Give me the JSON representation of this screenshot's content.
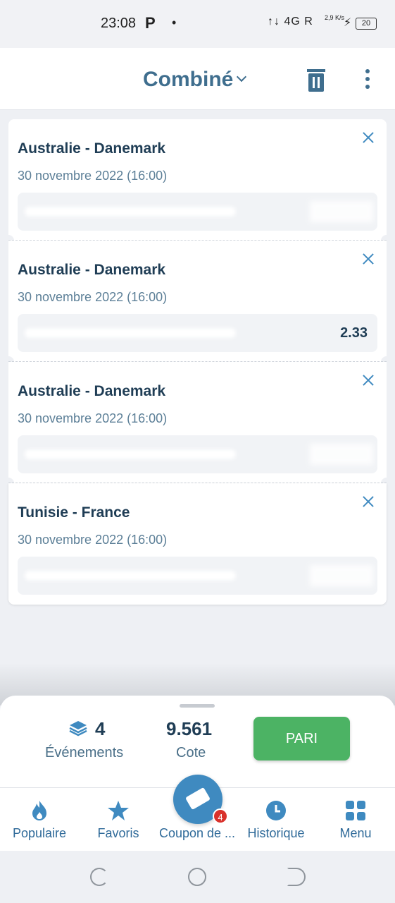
{
  "status_bar": {
    "time": "23:08",
    "app_indicator": "P",
    "dot": "•",
    "network": "↑↓ 4G R",
    "speed": "2,9 K/s",
    "battery": "20"
  },
  "header": {
    "title": "Combiné"
  },
  "bets": [
    {
      "match": "Australie - Danemark",
      "date": "30 novembre 2022 (16:00)",
      "odd": ""
    },
    {
      "match": "Australie - Danemark",
      "date": "30 novembre 2022 (16:00)",
      "odd": "2.33"
    },
    {
      "match": "Australie - Danemark",
      "date": "30 novembre 2022 (16:00)",
      "odd": ""
    },
    {
      "match": "Tunisie - France",
      "date": "30 novembre 2022 (16:00)",
      "odd": ""
    }
  ],
  "summary": {
    "events_count": "4",
    "events_label": "Événements",
    "odds": "9.561",
    "odds_label": "Cote",
    "bet_button": "PARI"
  },
  "tabs": [
    {
      "label": "Populaire",
      "icon": "flame-icon"
    },
    {
      "label": "Favoris",
      "icon": "star-icon"
    },
    {
      "label": "Coupon de ...",
      "icon": "ticket-icon",
      "badge": "4"
    },
    {
      "label": "Historique",
      "icon": "clock-icon"
    },
    {
      "label": "Menu",
      "icon": "grid-icon"
    }
  ],
  "colors": {
    "accent": "#3f8ac0",
    "title": "#3f6e8e",
    "bet_button": "#4cb364",
    "badge": "#d9312b"
  }
}
